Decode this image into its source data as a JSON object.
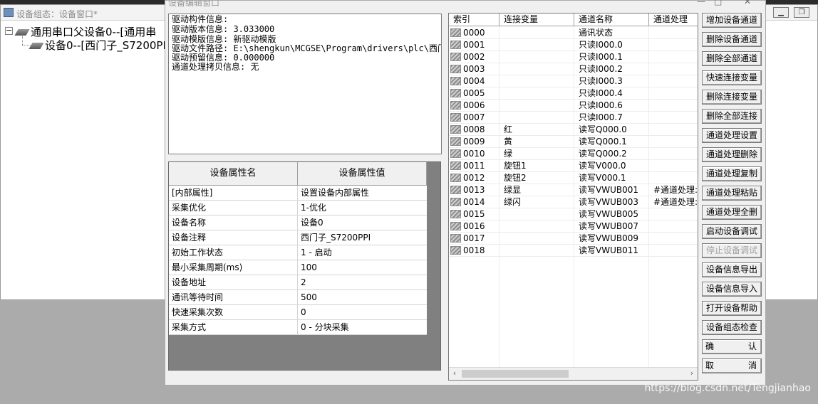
{
  "background_window": {
    "title": "设备组态：设备窗口*",
    "tree": {
      "root": "通用串口父设备0--[通用串",
      "child": "设备0--[西门子_S7200PI"
    }
  },
  "dialog": {
    "title": "设备编辑窗口",
    "driver_info": [
      "驱动构件信息:",
      "驱动版本信息: 3.033000",
      "驱动模版信息: 新驱动模版",
      "驱动文件路径: E:\\shengkun\\MCGSE\\Program\\drivers\\plc\\西门",
      "驱动预留信息: 0.000000",
      "通道处理拷贝信息: 无"
    ],
    "properties": {
      "headers": [
        "设备属性名",
        "设备属性值"
      ],
      "rows": [
        {
          "name": "[内部属性]",
          "value": "设置设备内部属性"
        },
        {
          "name": "采集优化",
          "value": "1-优化"
        },
        {
          "name": "设备名称",
          "value": "设备0"
        },
        {
          "name": "设备注释",
          "value": "西门子_S7200PPI"
        },
        {
          "name": "初始工作状态",
          "value": "1 - 启动"
        },
        {
          "name": "最小采集周期(ms)",
          "value": "100"
        },
        {
          "name": "设备地址",
          "value": "2"
        },
        {
          "name": "通讯等待时间",
          "value": "500"
        },
        {
          "name": "快速采集次数",
          "value": "0"
        },
        {
          "name": "采集方式",
          "value": "0 - 分块采集"
        }
      ]
    },
    "channels": {
      "headers": [
        "索引",
        "连接变量",
        "通道名称",
        "通道处理"
      ],
      "rows": [
        {
          "index": "0000",
          "var": "",
          "name": "通讯状态",
          "proc": ""
        },
        {
          "index": "0001",
          "var": "",
          "name": "只读I000.0",
          "proc": ""
        },
        {
          "index": "0002",
          "var": "",
          "name": "只读I000.1",
          "proc": ""
        },
        {
          "index": "0003",
          "var": "",
          "name": "只读I000.2",
          "proc": ""
        },
        {
          "index": "0004",
          "var": "",
          "name": "只读I000.3",
          "proc": ""
        },
        {
          "index": "0005",
          "var": "",
          "name": "只读I000.4",
          "proc": ""
        },
        {
          "index": "0006",
          "var": "",
          "name": "只读I000.6",
          "proc": ""
        },
        {
          "index": "0007",
          "var": "",
          "name": "只读I000.7",
          "proc": ""
        },
        {
          "index": "0008",
          "var": "红",
          "name": "读写Q000.0",
          "proc": ""
        },
        {
          "index": "0009",
          "var": "黄",
          "name": "读写Q000.1",
          "proc": ""
        },
        {
          "index": "0010",
          "var": "绿",
          "name": "读写Q000.2",
          "proc": ""
        },
        {
          "index": "0011",
          "var": "旋钮1",
          "name": "读写V000.0",
          "proc": ""
        },
        {
          "index": "0012",
          "var": "旋钮2",
          "name": "读写V000.1",
          "proc": ""
        },
        {
          "index": "0013",
          "var": "绿显",
          "name": "读写VWUB001",
          "proc": "#通道处理:"
        },
        {
          "index": "0014",
          "var": "绿闪",
          "name": "读写VWUB003",
          "proc": "#通道处理:"
        },
        {
          "index": "0015",
          "var": "",
          "name": "读写VWUB005",
          "proc": ""
        },
        {
          "index": "0016",
          "var": "",
          "name": "读写VWUB007",
          "proc": ""
        },
        {
          "index": "0017",
          "var": "",
          "name": "读写VWUB009",
          "proc": ""
        },
        {
          "index": "0018",
          "var": "",
          "name": "读写VWUB011",
          "proc": ""
        }
      ]
    },
    "buttons": [
      {
        "label": "增加设备通道",
        "enabled": true
      },
      {
        "label": "删除设备通道",
        "enabled": true
      },
      {
        "label": "删除全部通道",
        "enabled": true
      },
      {
        "label": "快速连接变量",
        "enabled": true
      },
      {
        "label": "删除连接变量",
        "enabled": true
      },
      {
        "label": "删除全部连接",
        "enabled": true
      },
      {
        "label": "通道处理设置",
        "enabled": true
      },
      {
        "label": "通道处理删除",
        "enabled": true
      },
      {
        "label": "通道处理复制",
        "enabled": true
      },
      {
        "label": "通道处理粘贴",
        "enabled": true
      },
      {
        "label": "通道处理全删",
        "enabled": true
      },
      {
        "label": "启动设备调试",
        "enabled": true
      },
      {
        "label": "停止设备调试",
        "enabled": false
      },
      {
        "label": "设备信息导出",
        "enabled": true
      },
      {
        "label": "设备信息导入",
        "enabled": true
      },
      {
        "label": "打开设备帮助",
        "enabled": true
      },
      {
        "label": "设备组态检查",
        "enabled": true
      }
    ],
    "confirm": {
      "left": "确",
      "right": "认"
    },
    "cancel": {
      "left": "取",
      "right": "消"
    }
  },
  "watermark": "https://blog.csdn.net/Tengjianhao",
  "icons": {
    "device": "device-icon",
    "channel_row": "channel-row-icon",
    "app": "app-icon"
  }
}
